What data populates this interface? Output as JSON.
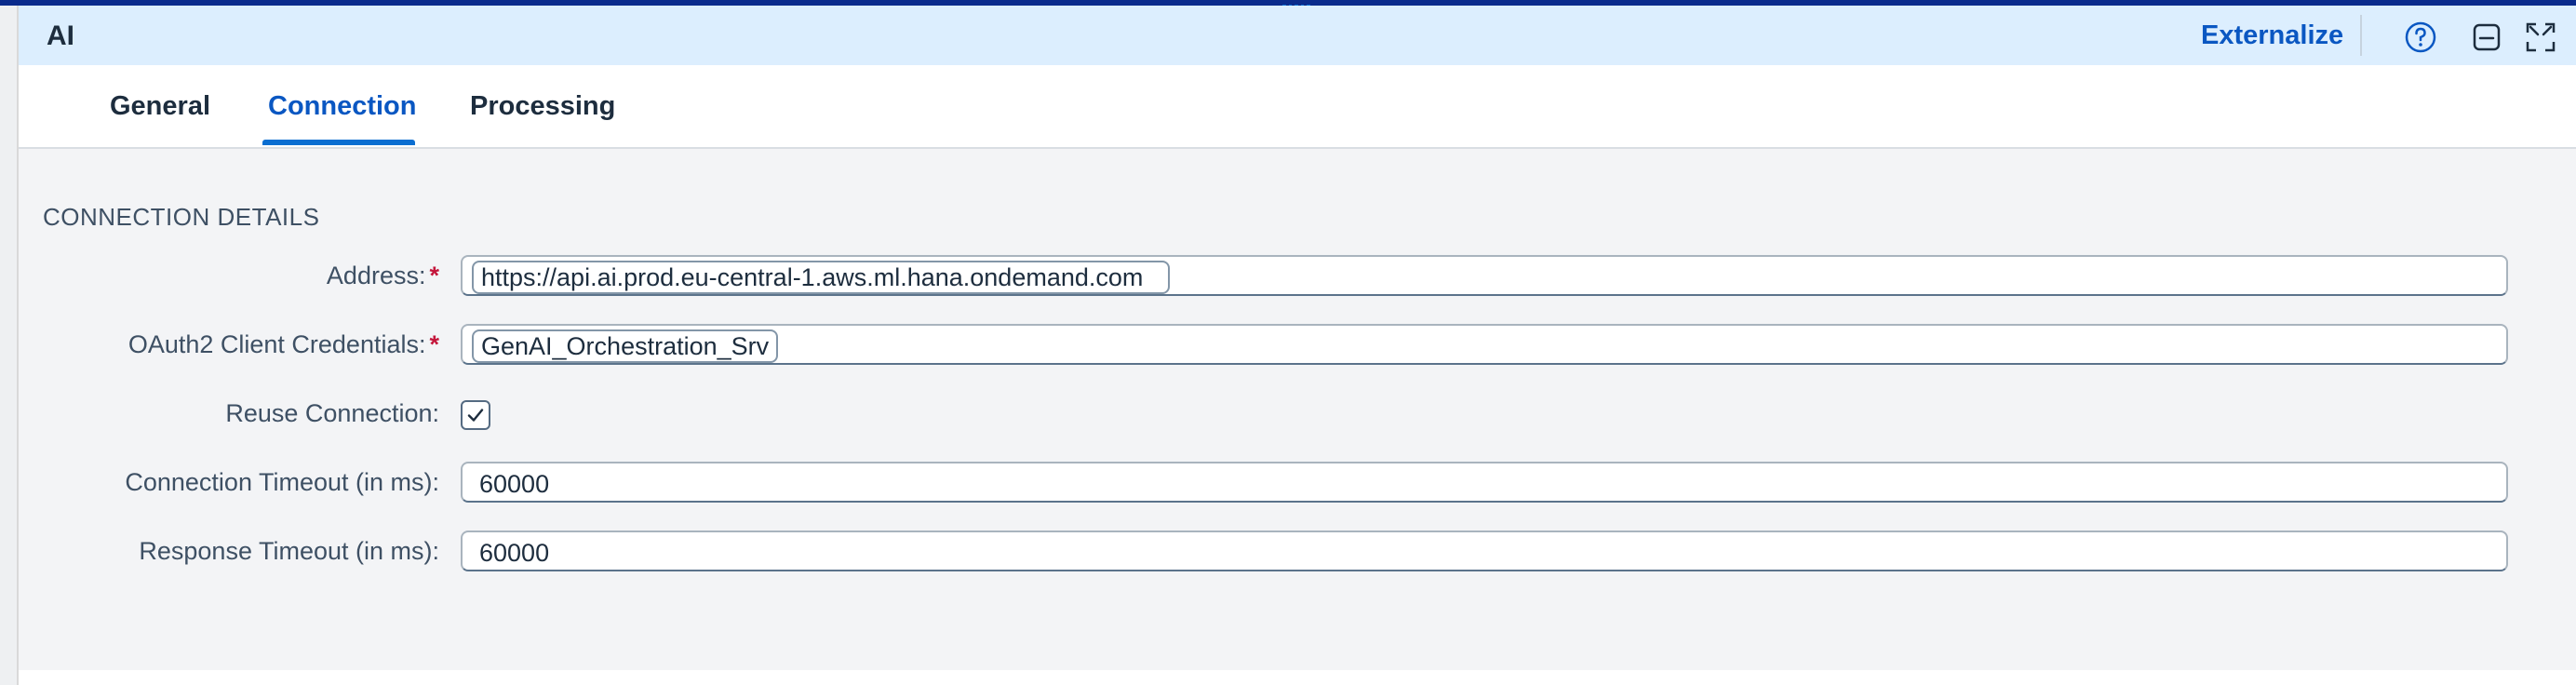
{
  "header": {
    "title": "AI",
    "externalize_label": "Externalize",
    "icons": [
      "help-icon",
      "minimize-icon",
      "fullscreen-icon"
    ]
  },
  "tabs": [
    {
      "label": "General",
      "active": false
    },
    {
      "label": "Connection",
      "active": true
    },
    {
      "label": "Processing",
      "active": false
    }
  ],
  "section": {
    "title": "CONNECTION DETAILS",
    "fields": {
      "address": {
        "label": "Address:",
        "required": true,
        "value": "https://api.ai.prod.eu-central-1.aws.ml.hana.ondemand.com"
      },
      "oauth": {
        "label": "OAuth2 Client Credentials:",
        "required": true,
        "value": "GenAI_Orchestration_Srv"
      },
      "reuse": {
        "label": "Reuse Connection:",
        "checked": true
      },
      "conn_timeout": {
        "label": "Connection Timeout (in ms):",
        "value": "60000"
      },
      "resp_timeout": {
        "label": "Response Timeout (in ms):",
        "value": "60000"
      }
    },
    "required_marker": "*"
  },
  "colors": {
    "header_bg": "#dceefe",
    "accent": "#0a57c2",
    "required": "#c4163b",
    "content_bg": "#f3f4f6"
  }
}
